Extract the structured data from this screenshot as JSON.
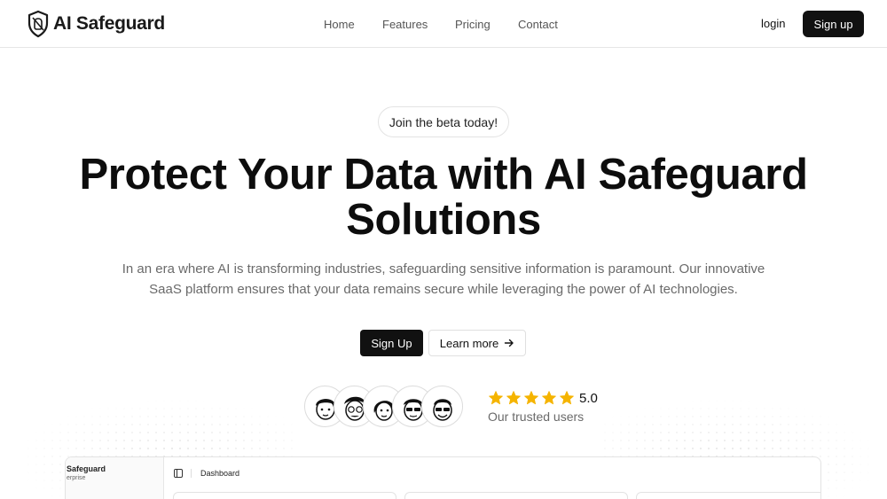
{
  "header": {
    "brand": "AI Safeguard",
    "nav": [
      "Home",
      "Features",
      "Pricing",
      "Contact"
    ],
    "login_label": "login",
    "signup_label": "Sign up"
  },
  "hero": {
    "beta_label": "Join the beta today!",
    "title_line1": "Protect Your Data with AI Safeguard",
    "title_line2": "Solutions",
    "subtitle_line1": "In an era where AI is transforming industries, safeguarding sensitive information is paramount. Our innovative",
    "subtitle_line2": "SaaS platform ensures that your data remains secure while leveraging the power of AI technologies.",
    "primary_cta": "Sign Up",
    "secondary_cta": "Learn more"
  },
  "social_proof": {
    "avatar_count": 5,
    "stars": 5,
    "score": "5.0",
    "label": "Our trusted users",
    "star_color": "#f5b400"
  },
  "dashboard_preview": {
    "brand": "Safeguard",
    "plan": "erprise",
    "breadcrumb": "Dashboard"
  },
  "colors": {
    "primary": "#111111",
    "muted_text": "#6a6a6a",
    "border": "#e3e3e3"
  }
}
